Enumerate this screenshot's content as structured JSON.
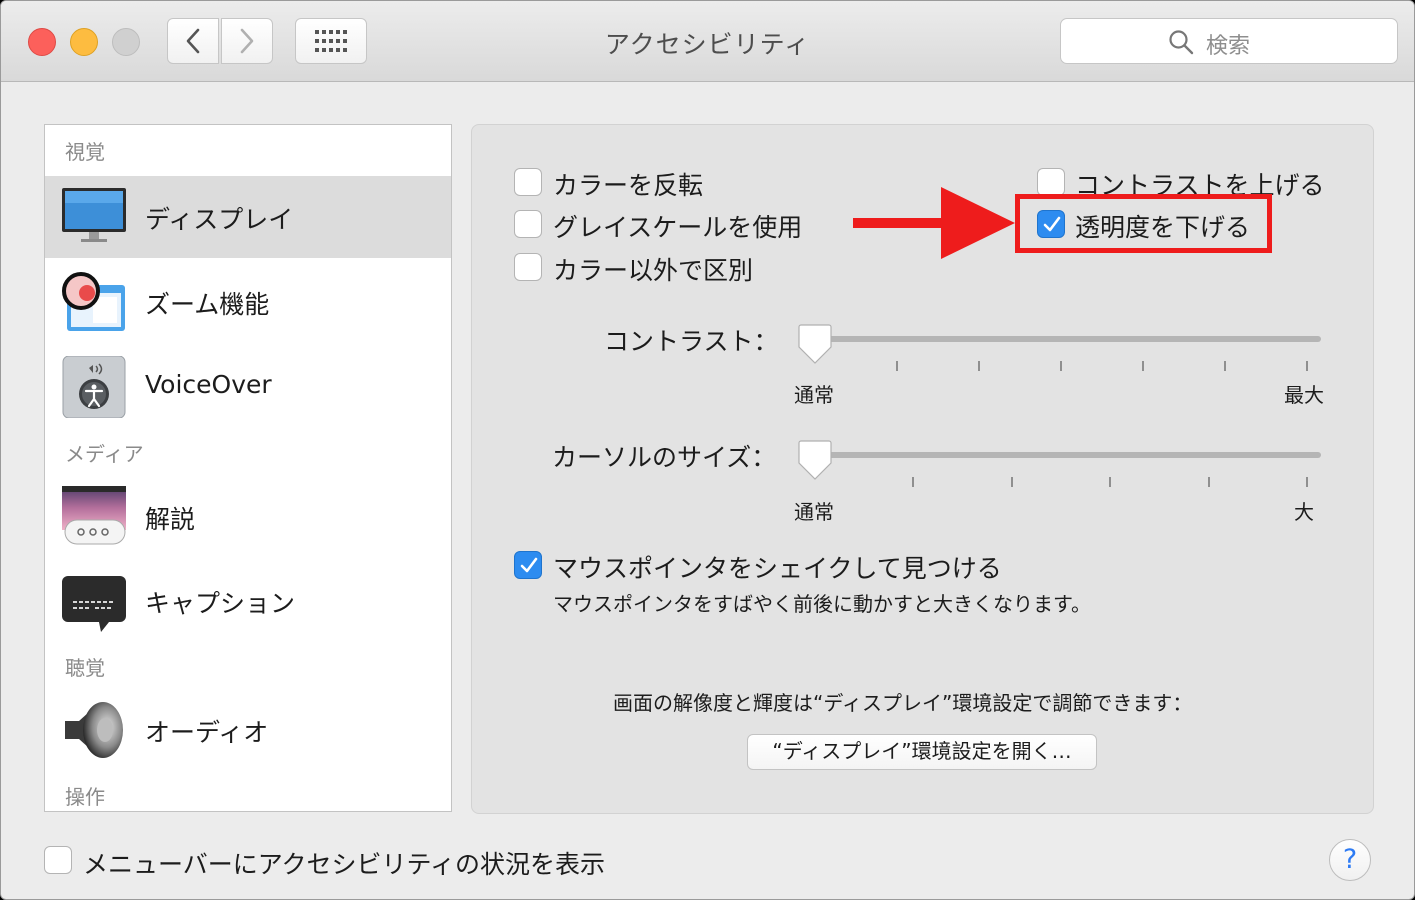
{
  "window": {
    "title": "アクセシビリティ",
    "search_placeholder": "検索"
  },
  "sidebar": {
    "sections": [
      {
        "heading": "視覚"
      },
      {
        "heading": "メディア"
      },
      {
        "heading": "聴覚"
      },
      {
        "heading": "操作"
      }
    ],
    "items": [
      {
        "label": "ディスプレイ",
        "icon": "display-icon",
        "selected": true
      },
      {
        "label": "ズーム機能",
        "icon": "zoom-icon"
      },
      {
        "label": "VoiceOver",
        "icon": "voiceover-icon"
      },
      {
        "label": "解説",
        "icon": "descriptions-icon"
      },
      {
        "label": "キャプション",
        "icon": "captions-icon"
      },
      {
        "label": "オーディオ",
        "icon": "speaker-icon"
      }
    ]
  },
  "options": {
    "invert_colors": {
      "label": "カラーを反転",
      "checked": false
    },
    "grayscale": {
      "label": "グレイスケールを使用",
      "checked": false
    },
    "differentiate": {
      "label": "カラー以外で区別",
      "checked": false
    },
    "increase_contrast": {
      "label": "コントラストを上げる",
      "checked": false
    },
    "reduce_transparency": {
      "label": "透明度を下げる",
      "checked": true
    }
  },
  "contrast_slider": {
    "label": "コントラスト：",
    "min_label": "通常",
    "max_label": "最大",
    "value": 0
  },
  "cursor_slider": {
    "label": "カーソルのサイズ：",
    "min_label": "通常",
    "max_label": "大",
    "value": 0
  },
  "shake_pointer": {
    "label": "マウスポインタをシェイクして見つける",
    "checked": true,
    "description": "マウスポインタをすばやく前後に動かすと大きくなります。"
  },
  "display_note": "画面の解像度と輝度は“ディスプレイ”環境設定で調節できます：",
  "open_display_button": "“ディスプレイ”環境設定を開く…",
  "footer": {
    "menubar_status": {
      "label": "メニューバーにアクセシビリティの状況を表示",
      "checked": false
    },
    "help": "?"
  },
  "colors": {
    "accent": "#2d8cf0",
    "highlight": "#ee1c1c"
  }
}
